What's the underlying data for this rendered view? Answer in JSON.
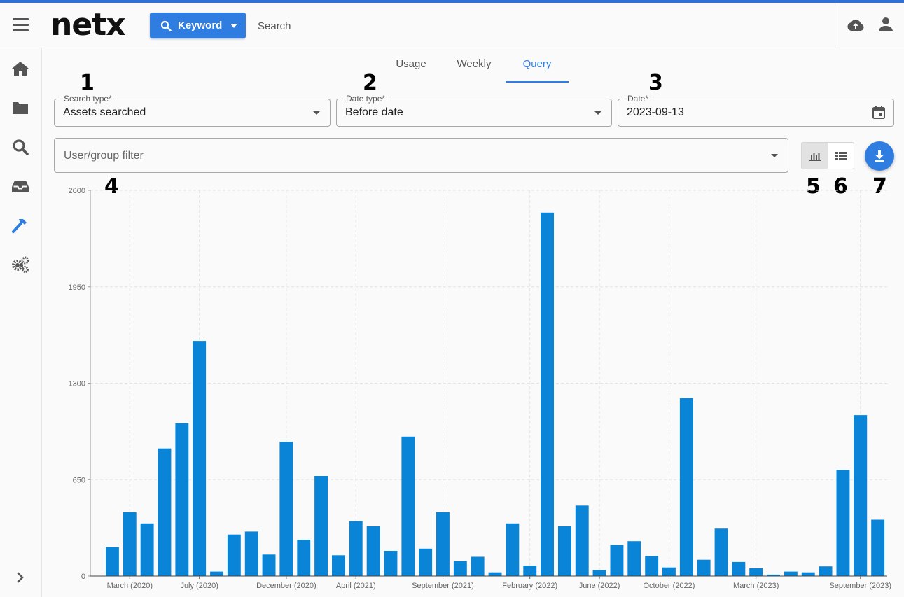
{
  "header": {
    "logo": "netx",
    "keyword_button": "Keyword",
    "search_placeholder": "Search",
    "icons": [
      "menu-icon",
      "search-icon",
      "upload-cloud-icon",
      "user-icon"
    ]
  },
  "sidebar": {
    "items": [
      {
        "icon": "home-icon"
      },
      {
        "icon": "folder-icon"
      },
      {
        "icon": "search-icon"
      },
      {
        "icon": "inbox-icon"
      },
      {
        "icon": "hammer-icon",
        "active": true
      },
      {
        "icon": "gears-icon"
      }
    ],
    "expand_icon": "chevron-right-icon"
  },
  "tabs": [
    {
      "label": "Usage"
    },
    {
      "label": "Weekly"
    },
    {
      "label": "Query",
      "active": true
    }
  ],
  "callouts": [
    "1",
    "2",
    "3",
    "4",
    "5",
    "6",
    "7"
  ],
  "form": {
    "search_type": {
      "label": "Search type",
      "required": "*",
      "value": "Assets searched"
    },
    "date_type": {
      "label": "Date type",
      "required": "*",
      "value": "Before date"
    },
    "date": {
      "label": "Date",
      "required": "*",
      "value": "2023-09-13"
    },
    "user_group": {
      "placeholder": "User/group filter"
    }
  },
  "view_toggle": {
    "selected": "chart",
    "icons": [
      "bar-chart-icon",
      "list-icon"
    ]
  },
  "download_icon": "download-icon",
  "colors": {
    "accent": "#2f7de1",
    "bar": "#0a84d6",
    "topline": "#2f6fd6"
  },
  "chart_data": {
    "type": "bar",
    "ylim": [
      0,
      2600
    ],
    "yticks": [
      "0",
      "650",
      "1300",
      "1950",
      "2600"
    ],
    "grid": true,
    "series": [
      {
        "values": [
          195,
          430,
          355,
          860,
          1030,
          1585,
          30,
          280,
          300,
          145,
          905,
          245,
          675,
          140,
          370,
          335,
          170,
          940,
          185,
          430,
          100,
          130,
          25,
          355,
          70,
          2450,
          335,
          475,
          40,
          210,
          235,
          135,
          58,
          1200,
          110,
          320,
          95,
          52,
          10,
          30,
          25,
          65,
          715,
          1085,
          380
        ]
      }
    ],
    "xlabels": [
      {
        "i": 1,
        "text": "March (2020)"
      },
      {
        "i": 5,
        "text": "July (2020)"
      },
      {
        "i": 10,
        "text": "December (2020)"
      },
      {
        "i": 14,
        "text": "April (2021)"
      },
      {
        "i": 19,
        "text": "September (2021)"
      },
      {
        "i": 24,
        "text": "February (2022)"
      },
      {
        "i": 28,
        "text": "June (2022)"
      },
      {
        "i": 32,
        "text": "October (2022)"
      },
      {
        "i": 37,
        "text": "March (2023)"
      },
      {
        "i": 43,
        "text": "September (2023)"
      }
    ]
  }
}
